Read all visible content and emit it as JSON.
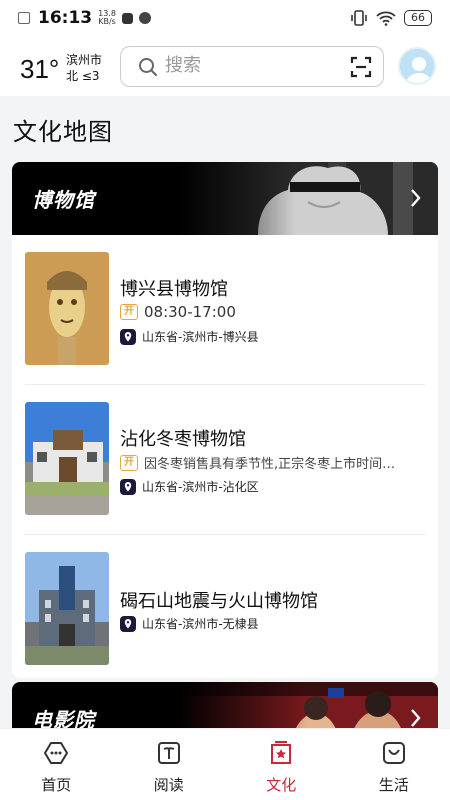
{
  "status_bar": {
    "time": "16:13",
    "net_speed_value": "13.8",
    "net_speed_unit": "KB/s",
    "battery": "66"
  },
  "header": {
    "temperature": "31°",
    "city": "滨州市",
    "wind": "北 ≤3",
    "search_placeholder": "搜索"
  },
  "page_title": "文化地图",
  "categories": [
    {
      "title": "博物馆",
      "places": [
        {
          "name": "博兴县博物馆",
          "badge": "开",
          "info": "08:30-17:00",
          "address": "山东省-滨州市-博兴县"
        },
        {
          "name": "沾化冬枣博物馆",
          "badge": "开",
          "info": "因冬枣销售具有季节性,正宗冬枣上市时间…",
          "address": "山东省-滨州市-沾化区"
        },
        {
          "name": "碣石山地震与火山博物馆",
          "address": "山东省-滨州市-无棣县"
        }
      ]
    },
    {
      "title": "电影院"
    }
  ],
  "bottom_nav": [
    {
      "label": "首页",
      "icon": "home-icon"
    },
    {
      "label": "阅读",
      "icon": "book-icon"
    },
    {
      "label": "文化",
      "icon": "culture-icon",
      "active": true
    },
    {
      "label": "生活",
      "icon": "bag-icon"
    }
  ],
  "colors": {
    "accent": "#c7283b",
    "badge_orange": "#e7a63d",
    "pin_dark": "#1c1a3b"
  }
}
